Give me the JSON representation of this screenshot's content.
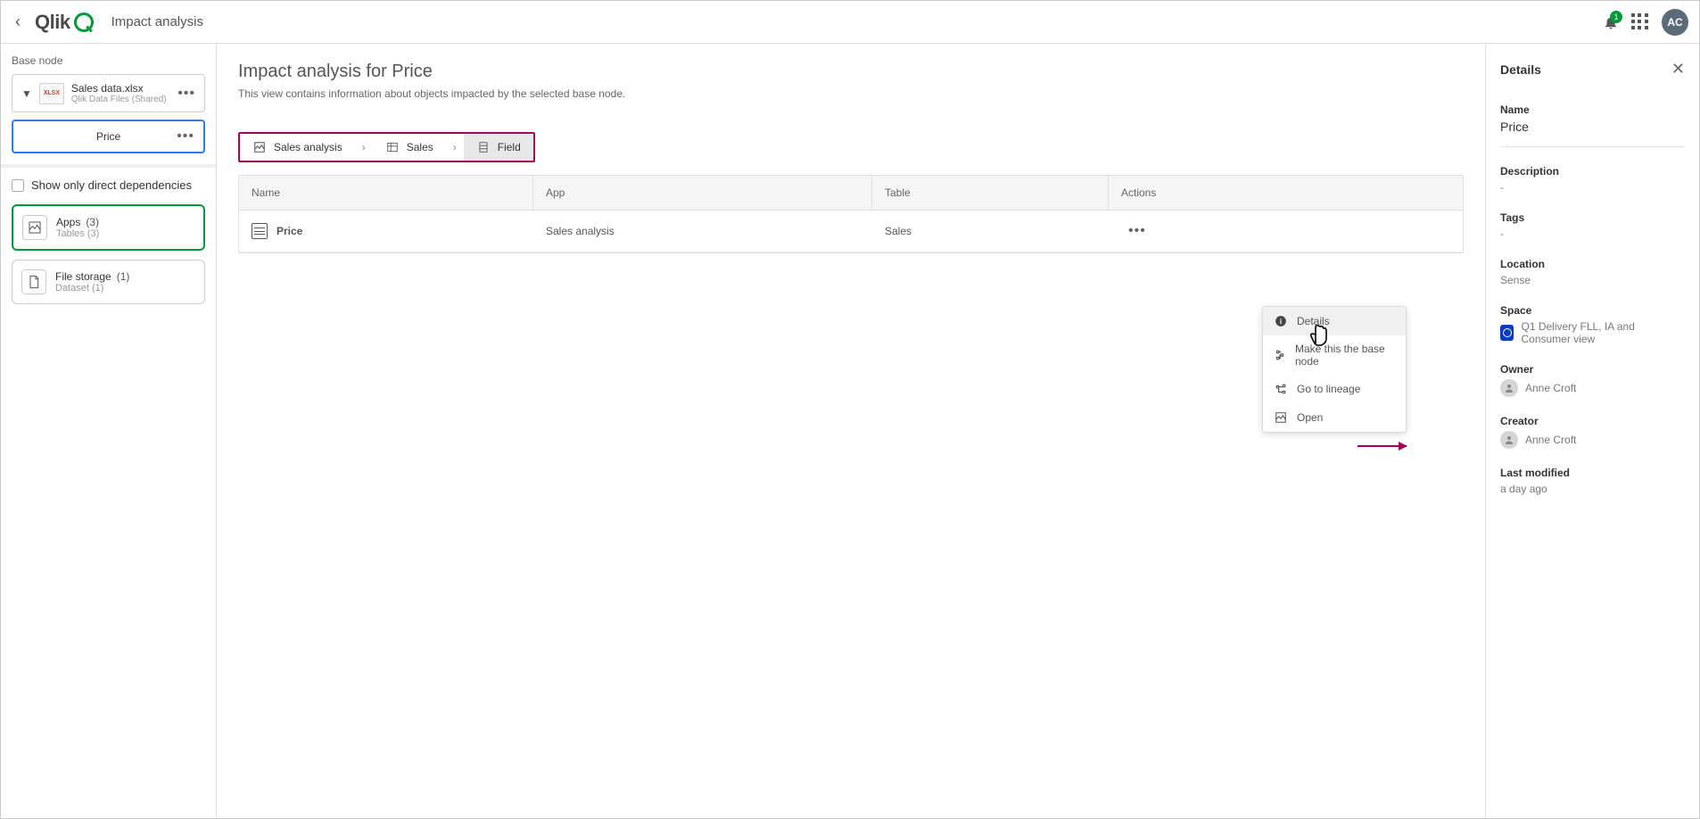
{
  "header": {
    "logo_text": "Qlik",
    "page_title": "Impact analysis",
    "badge_count": "1",
    "avatar_initials": "AC"
  },
  "sidebar": {
    "base_node_label": "Base node",
    "base_node": {
      "file_name": "Sales data.xlsx",
      "file_sub": "Qlik Data Files (Shared)",
      "file_icon_text": "XLSX"
    },
    "selected_field": "Price",
    "checkbox_label": "Show only direct dependencies",
    "cards": [
      {
        "title": "Apps",
        "count": "(3)",
        "sub": "Tables (3)"
      },
      {
        "title": "File storage",
        "count": "(1)",
        "sub": "Dataset (1)"
      }
    ]
  },
  "main": {
    "heading": "Impact analysis for Price",
    "subtitle": "This view contains information about objects impacted by the selected base node.",
    "breadcrumb": [
      "Sales analysis",
      "Sales",
      "Field"
    ],
    "columns": [
      "Name",
      "App",
      "Table",
      "Actions"
    ],
    "row": {
      "name": "Price",
      "app": "Sales analysis",
      "table": "Sales"
    },
    "context_menu": [
      "Details",
      "Make this the base node",
      "Go to lineage",
      "Open"
    ]
  },
  "details": {
    "panel_title": "Details",
    "name_label": "Name",
    "name_value": "Price",
    "desc_label": "Description",
    "desc_value": "-",
    "tags_label": "Tags",
    "tags_value": "-",
    "location_label": "Location",
    "location_value": "Sense",
    "space_label": "Space",
    "space_value": "Q1 Delivery FLL, IA and Consumer view",
    "owner_label": "Owner",
    "owner_value": "Anne Croft",
    "creator_label": "Creator",
    "creator_value": "Anne Croft",
    "modified_label": "Last modified",
    "modified_value": "a day ago"
  }
}
